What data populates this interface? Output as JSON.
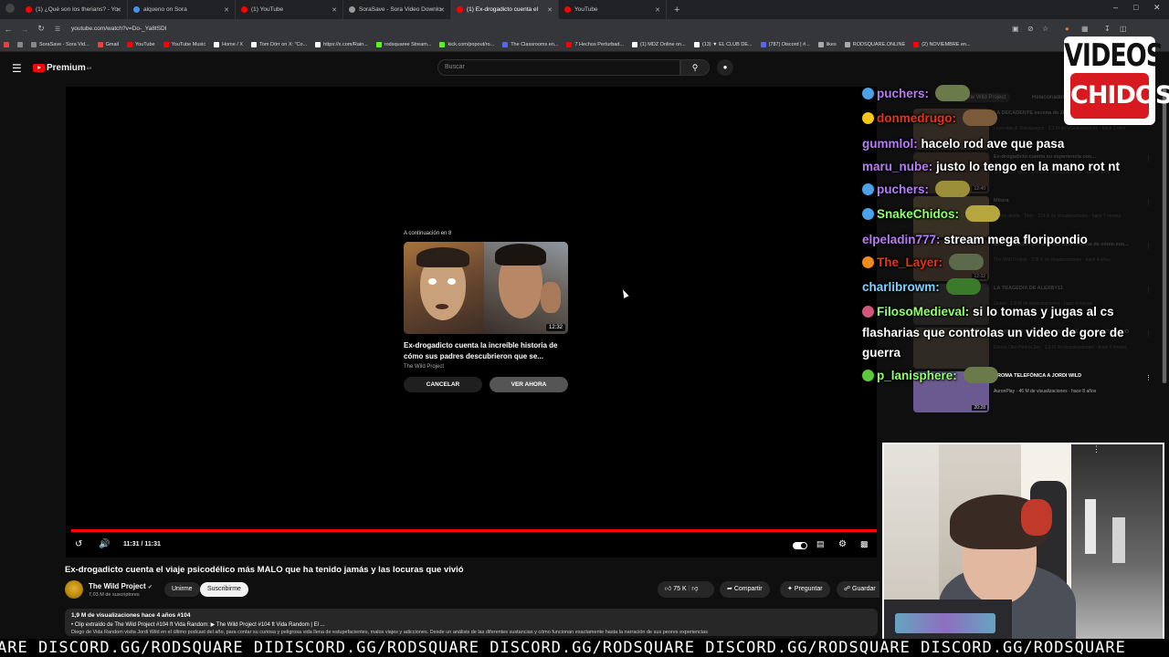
{
  "browser": {
    "tabs": [
      {
        "label": "(1) ¿Qué son los therians? - Yo",
        "color": "#ff0000"
      },
      {
        "label": "alqueno on Sora",
        "color": "#4a90e2"
      },
      {
        "label": "(1) YouTube",
        "color": "#ff0000"
      },
      {
        "label": "SoraSave - Sora Video Downlo",
        "color": "#999999"
      },
      {
        "label": "(1) Ex-drogadicto cuenta el",
        "color": "#ff0000"
      },
      {
        "label": "YouTube",
        "color": "#ff0000"
      }
    ],
    "url": "youtube.com/watch?v=Do-_Ya8tSDI",
    "bookmarks": [
      {
        "label": "SoraSave - Sora Vid...",
        "color": "#888888"
      },
      {
        "label": "Gmail",
        "color": "#ea4335"
      },
      {
        "label": "YouTube",
        "color": "#ff0000"
      },
      {
        "label": "YouTube Music",
        "color": "#ff0000"
      },
      {
        "label": "Home / X",
        "color": "#ffffff"
      },
      {
        "label": "Tom Dörr on X: \"Co...",
        "color": "#ffffff"
      },
      {
        "label": "https://x.com/Rain...",
        "color": "#ffffff"
      },
      {
        "label": "rodsquaree Stream...",
        "color": "#53fc18"
      },
      {
        "label": "kick.com/popout/ro...",
        "color": "#53fc18"
      },
      {
        "label": "The Classrooms en...",
        "color": "#5865f2"
      },
      {
        "label": "7 Hechos Perturbad...",
        "color": "#ff0000"
      },
      {
        "label": "(1) MDZ Online on...",
        "color": "#ffffff"
      },
      {
        "label": "(13) ▼ EL CLUB DE...",
        "color": "#ffffff"
      },
      {
        "label": "(787) Discord | #...",
        "color": "#5865f2"
      },
      {
        "label": "likes",
        "color": "#aaaaaa"
      },
      {
        "label": "RODSQUARE.ONLINE",
        "color": "#aaaaaa"
      },
      {
        "label": "(2) NOVIEMBRE en...",
        "color": "#ff0000"
      }
    ]
  },
  "youtube": {
    "brand": "Premium",
    "region": "AR",
    "search_placeholder": "Buscar"
  },
  "player": {
    "upnext_label": "A continuación en 8",
    "upnext_duration": "12:32",
    "upnext_title": "Ex-drogadicto cuenta la increíble historia de cómo sus padres descubrieron que se...",
    "upnext_channel": "The Wild Project",
    "cancel_label": "CANCELAR",
    "watch_label": "VER AHORA",
    "timecode": "11:31 / 11:31",
    "progress": 1.0
  },
  "video": {
    "title": "Ex-drogadicto cuenta el viaje psicodélico más MALO que ha tenido jamás y las locuras que vivió",
    "channel": "The Wild Project",
    "subscribers": "7,03 M de suscriptores",
    "join_label": "Unirme",
    "subscribe_label": "Suscribirme",
    "likes": "75 K",
    "share_label": "Compartir",
    "ask_label": "Preguntar",
    "save_label": "Guardar",
    "views_line": "1,9 M de visualizaciones  hace 4 años  #104",
    "clip_line": "• Clip extraído de The Wild Project #104 ft Vida Random:  ▶ The Wild Project #104 ft Vida Random | El ...",
    "desc_line": "Diego de Vida Random visita Jordi Wild en el último podcast del año, para contar su curiosa y peligrosa vida llena de estupefacientes, malos viajes y adicciones. Desde un análisis de las diferentes sustancias y cómo funcionan exactamente hasta la narración de sus peores experiencias"
  },
  "related": {
    "tabs": [
      "The Wild Project",
      "Relacionados"
    ],
    "items": [
      {
        "title": "LA DECADENTE escena de JUEGOS DE YOUTUBERS",
        "meta": "Leyendas & Videojuegos · 2,1 M de visualizaciones · hace 1 mes",
        "duration": "",
        "color": "#5b4a3a"
      },
      {
        "title": "Ex-drogadicto cuenta su experiencia con...",
        "meta": "The Wild Project · 1,4 M de visualizaciones · hace 4 años",
        "duration": "12:40",
        "color": "#4d3b2e"
      },
      {
        "title": "Mitura",
        "meta": "Marca aliada · Timo · 224 K de visualizaciones · hace 7 meses",
        "duration": "",
        "color": "#6b5c3d"
      },
      {
        "title": "Ex-drogadicto cuenta la increíble historia de cómo sus...",
        "meta": "The Wild Project · 378 K de visualizaciones · hace 4 años",
        "duration": "12:32",
        "color": "#5a4638"
      },
      {
        "title": "LA TRAGEDIA DE ALEXBY11",
        "meta": "Grave · 1,8 M de visualizaciones · hace 4 meses",
        "duration": "",
        "color": "#3e3a36"
      },
      {
        "title": "MOMENTOS MÁS PELIGROSOS DE ZAZZA EL ITALIANO",
        "meta": "Donde Otro Podría Ser · 1,3 M de visualizaciones · hace 6 meses",
        "duration": "",
        "color": "#55493a"
      },
      {
        "title": "BROMA TELEFÓNICA A JORDI WILD",
        "meta": "AuronPlay · 46 M de visualizaciones · hace 8 años",
        "duration": "20:28",
        "color": "#6a5a8f"
      }
    ]
  },
  "chat": [
    {
      "user": "puchers",
      "userColor": "#b57cf5",
      "badge": "#4aa3e8",
      "text": "",
      "emote": "#6b7a4a"
    },
    {
      "user": "donmedrugo",
      "userColor": "#e8321a",
      "badge": "#f5c518",
      "text": "",
      "emote": "#7a5a3a"
    },
    {
      "user": "gummlol",
      "userColor": "#b57cf5",
      "badge": "",
      "text": "hacelo rod ave que pasa",
      "emote": ""
    },
    {
      "user": "maru_nube",
      "userColor": "#b57cf5",
      "badge": "",
      "text": "justo lo tengo en la mano rot nt",
      "emote": ""
    },
    {
      "user": "puchers",
      "userColor": "#b57cf5",
      "badge": "#4aa3e8",
      "text": "",
      "emote": "#9c8f3a"
    },
    {
      "user": "SnakeChidos",
      "userColor": "#8fff6a",
      "badge": "#4aa3e8",
      "text": "",
      "emote": "#b5a640"
    },
    {
      "user": "elpeladin777",
      "userColor": "#b57cf5",
      "badge": "",
      "text": "stream mega floripondio",
      "emote": ""
    },
    {
      "user": "The_Layer",
      "userColor": "#e8321a",
      "badge": "#f08a1a",
      "text": "",
      "emote": "#5a6a4a"
    },
    {
      "user": "charlibrowm",
      "userColor": "#7fd4ff",
      "badge": "",
      "text": "",
      "emote": "#3a7a2a"
    },
    {
      "user": "FilosoMedieval",
      "userColor": "#8fff6a",
      "badge": "#d2567a",
      "text": "si lo tomas y jugas al cs",
      "emote": ""
    },
    {
      "user": "",
      "userColor": "#ffffff",
      "badge": "",
      "text": "flasharias que controlas un video de gore de",
      "emote": ""
    },
    {
      "user": "",
      "userColor": "#ffffff",
      "badge": "",
      "text": "guerra",
      "emote": ""
    },
    {
      "user": "p_lanisphere",
      "userColor": "#8fff6a",
      "badge": "#5cc83a",
      "text": "",
      "emote": "#6a7a4a"
    }
  ],
  "overlay_logo": {
    "line1": "VIDEOS",
    "line2": "CHIDOS"
  },
  "ticker": "ARE DISCORD.GG/RODSQUARE DIDISCORD.GG/RODSQUARE DISCORD.GG/RODSQUARE DISCORD.GG/RODSQUARE DISCORD.GG/RODSQUARE"
}
